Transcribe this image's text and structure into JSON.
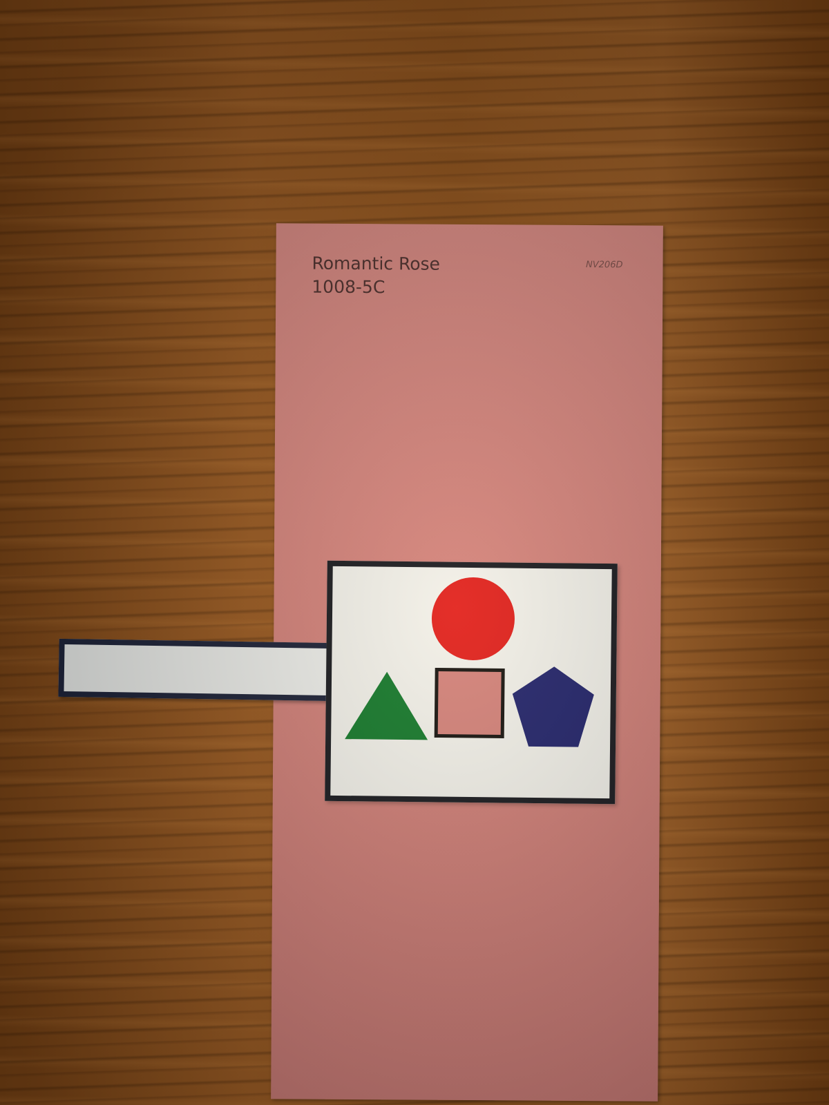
{
  "paint_chip": {
    "name": "Romantic Rose",
    "number": "1008-5C",
    "code": "NV206D",
    "color": "#d4837f"
  },
  "shape_card": {
    "shapes": [
      {
        "name": "circle",
        "color": "#e11d1d"
      },
      {
        "name": "triangle",
        "color": "#0f7a2e"
      },
      {
        "name": "square-cutout",
        "color": "#111111"
      },
      {
        "name": "pentagon",
        "color": "#1d2270"
      }
    ]
  }
}
